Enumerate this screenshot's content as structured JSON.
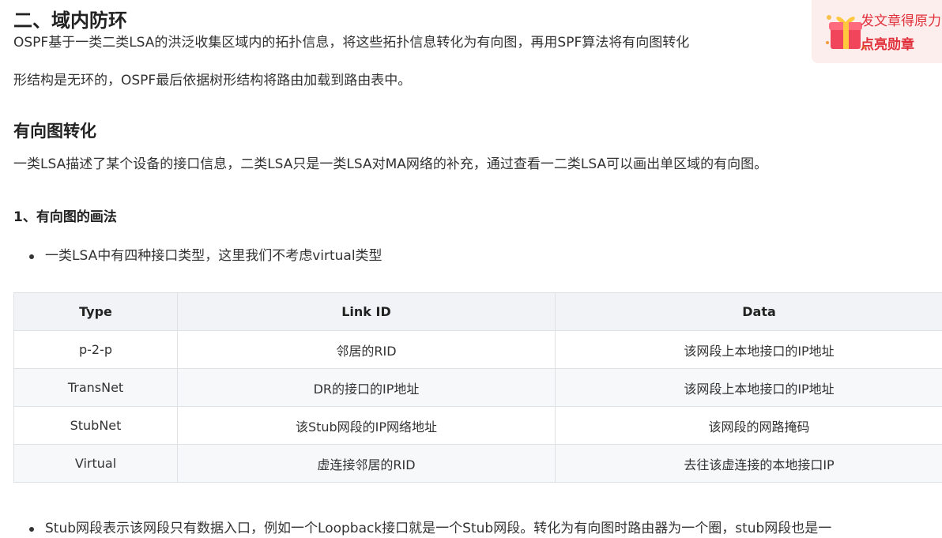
{
  "article": {
    "section_title": "二、域内防环",
    "intro_line1": "OSPF基于一类二类LSA的洪泛收集区域内的拓扑信息，将这些拓扑信息转化为有向图，再用SPF算法将有向图转化",
    "intro_line2": "形结构是无环的，OSPF最后依据树形结构将路由加载到路由表中。",
    "subsection_title": "有向图转化",
    "sub_para": "一类LSA描述了某个设备的接口信息，二类LSA只是一类LSA对MA网络的补充，通过查看一二类LSA可以画出单区域的有向图。",
    "minor_title": "1、有向图的画法",
    "bullet1": "一类LSA中有四种接口类型，这里我们不考虑virtual类型",
    "bullet2": "Stub网段表示该网段只有数据入口，例如一个Loopback接口就是一个Stub网段。转化为有向图时路由器为一个圈，stub网段也是一"
  },
  "table": {
    "headers": [
      "Type",
      "Link ID",
      "Data"
    ],
    "rows": [
      [
        "p-2-p",
        "邻居的RID",
        "该网段上本地接口的IP地址"
      ],
      [
        "TransNet",
        "DR的接口的IP地址",
        "该网段上本地接口的IP地址"
      ],
      [
        "StubNet",
        "该Stub网段的IP网络地址",
        "该网段的网路掩码"
      ],
      [
        "Virtual",
        "虚连接邻居的RID",
        "去往该虚连接的本地接口IP"
      ]
    ]
  },
  "promo": {
    "line1": "发文章得原力",
    "line2": "点亮勋章",
    "icon": "gift-box-icon",
    "accent_color": "#e0303a"
  }
}
